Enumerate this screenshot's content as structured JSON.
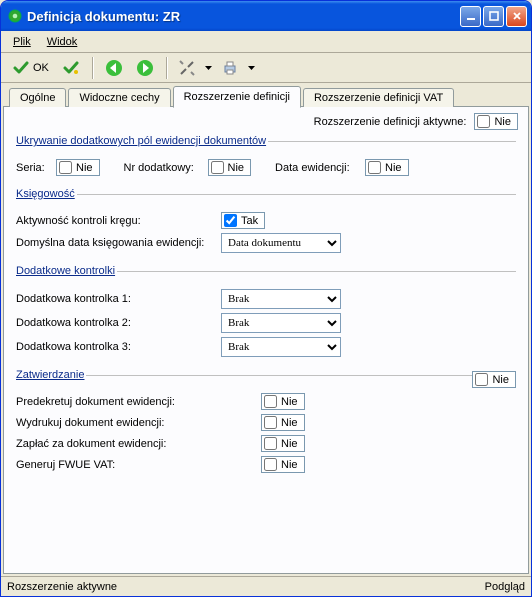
{
  "window": {
    "title": "Definicja dokumentu: ZR"
  },
  "menu": {
    "plik": "Plik",
    "widok": "Widok"
  },
  "toolbar": {
    "ok": "OK"
  },
  "tabs": {
    "t0": "Ogólne",
    "t1": "Widoczne cechy",
    "t2": "Rozszerzenie definicji",
    "t3": "Rozszerzenie definicji VAT"
  },
  "top": {
    "active_label": "Rozszerzenie definicji aktywne:",
    "active_value": "Nie"
  },
  "hide": {
    "legend": "Ukrywanie dodatkowych pól ewidencji dokumentów",
    "seria_lbl": "Seria:",
    "seria_val": "Nie",
    "nr_lbl": "Nr dodatkowy:",
    "nr_val": "Nie",
    "data_lbl": "Data ewidencji:",
    "data_val": "Nie"
  },
  "acct": {
    "legend": "Księgowość",
    "kontrola_lbl": "Aktywność kontroli kręgu:",
    "kontrola_val": "Tak",
    "defdate_lbl": "Domyślna data księgowania ewidencji:",
    "defdate_val": "Data dokumentu"
  },
  "ctrl": {
    "legend": "Dodatkowe kontrolki",
    "k1_lbl": "Dodatkowa kontrolka 1:",
    "k1_val": "Brak",
    "k2_lbl": "Dodatkowa kontrolka 2:",
    "k2_val": "Brak",
    "k3_lbl": "Dodatkowa kontrolka 3:",
    "k3_val": "Brak"
  },
  "approve": {
    "legend": "Zatwierdzanie",
    "aside_val": "Nie",
    "predekret_lbl": "Predekretuj dokument ewidencji:",
    "predekret_val": "Nie",
    "wydruk_lbl": "Wydrukuj dokument ewidencji:",
    "wydruk_val": "Nie",
    "zaplac_lbl": "Zapłać za dokument ewidencji:",
    "zaplac_val": "Nie",
    "fwue_lbl": "Generuj FWUE VAT:",
    "fwue_val": "Nie"
  },
  "status": {
    "left": "Rozszerzenie aktywne",
    "right": "Podgląd"
  }
}
